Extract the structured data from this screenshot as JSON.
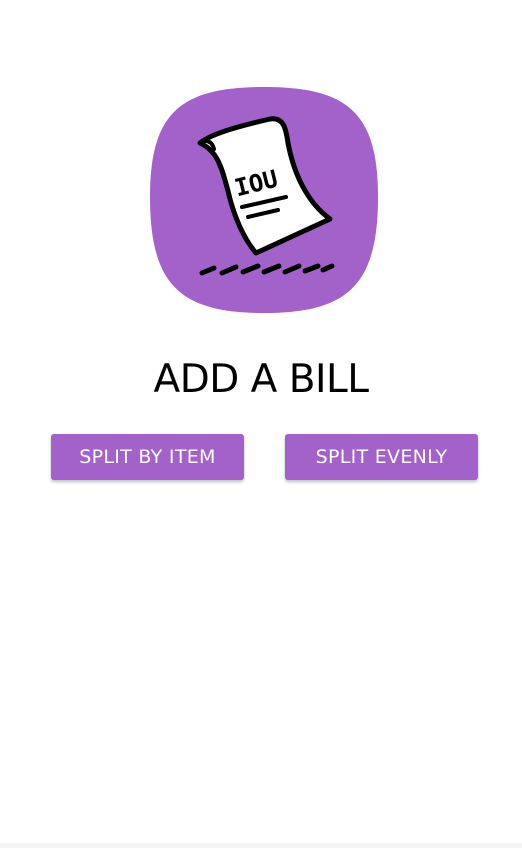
{
  "theme": {
    "accent": "#a362c9",
    "background": "#ffffff"
  },
  "logo": {
    "icon": "iou-receipt-icon",
    "text": "IOU"
  },
  "title": "ADD A BILL",
  "actions": {
    "split_by_item": "SPLIT BY ITEM",
    "split_evenly": "SPLIT EVENLY"
  }
}
